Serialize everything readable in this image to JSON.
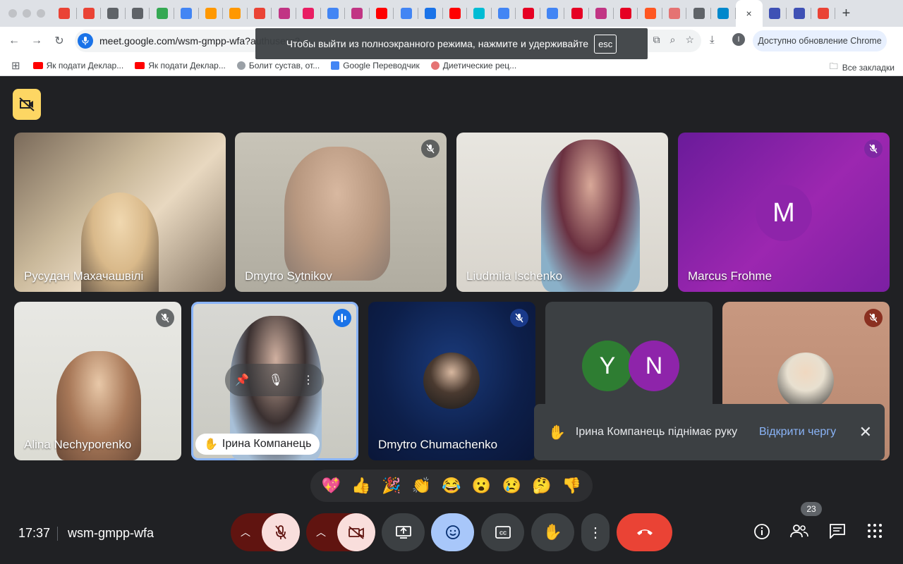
{
  "browser": {
    "url": "meet.google.com/wsm-gmpp-wfa?authuser=2",
    "update_label": "Доступно обновление Chrome",
    "fullscreen_hint": "Чтобы выйти из полноэкранного режима, нажмите и удерживайте",
    "esc_label": "esc",
    "tab_close": "×",
    "new_tab": "+",
    "bookmarks": [
      {
        "label": "Як подати Деклар...",
        "color": "#ff0000"
      },
      {
        "label": "Як подати Деклар...",
        "color": "#ff0000"
      },
      {
        "label": "Болит сустав, от...",
        "color": "#9aa0a6"
      },
      {
        "label": "Google Переводчик",
        "color": "#4285f4"
      },
      {
        "label": "Диетические рец...",
        "color": "#e57373"
      }
    ],
    "all_bookmarks": "Все закладки"
  },
  "participants": [
    {
      "name": "Русудан Махачашвілі",
      "muted": false
    },
    {
      "name": "Dmytro Sytnikov",
      "muted": true
    },
    {
      "name": "Liudmila Ischenko",
      "muted": false
    },
    {
      "name": "Marcus Frohme",
      "muted": true,
      "initial": "M"
    },
    {
      "name": "Alina Nechyporenko",
      "muted": true
    },
    {
      "name": "Ірина Компанець",
      "hand_raised": true,
      "speaking": true
    },
    {
      "name": "Dmytro Chumachenko",
      "muted": true
    },
    {
      "initials": [
        "Y",
        "N"
      ]
    },
    {
      "name": "",
      "muted": true
    }
  ],
  "toast": {
    "message": "Ірина Компанець піднімає руку",
    "action": "Відкрити чергу"
  },
  "reactions": [
    "💖",
    "👍",
    "🎉",
    "👏",
    "😂",
    "😮",
    "😢",
    "🤔",
    "👎"
  ],
  "meeting": {
    "time": "17:37",
    "code": "wsm-gmpp-wfa",
    "participant_count": "23"
  },
  "colors": {
    "accent": "#8ab4f8",
    "end_call": "#ea4335",
    "mic_off_bg": "#f9dedc",
    "dark_red": "#601410"
  }
}
